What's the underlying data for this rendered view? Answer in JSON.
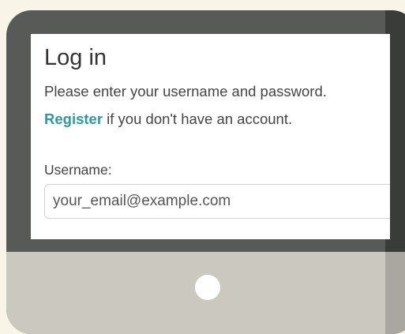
{
  "login": {
    "title": "Log in",
    "instructions": "Please enter your username and password.",
    "register_link": "Register",
    "register_suffix": " if you don't have an account.",
    "username_label": "Username:",
    "username_placeholder": "your_email@example.com"
  },
  "colors": {
    "background": "#f8f5e8",
    "tablet_frame": "#585a58",
    "tablet_bottom": "#cbc8bf",
    "link": "#2a9aa8"
  }
}
